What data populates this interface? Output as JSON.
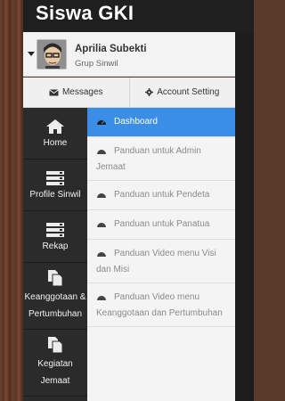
{
  "header": {
    "brand": "Siswa GKI"
  },
  "user": {
    "name": "Aprilia Subekti",
    "group": "Grup Sinwil"
  },
  "actions": {
    "messages": "Messages",
    "account": "Account Setting"
  },
  "nav": [
    {
      "label": "Home",
      "icon": "home-icon"
    },
    {
      "label": "Profile Sinwil",
      "icon": "list-icon"
    },
    {
      "label": "Rekap",
      "icon": "list-icon"
    },
    {
      "label": "Keanggotaan & Pertumbuhan",
      "icon": "copy-icon"
    },
    {
      "label": "Kegiatan Jemaat",
      "icon": "copy-icon"
    }
  ],
  "submenu": [
    {
      "label": "Dashboard",
      "active": true
    },
    {
      "label": "Panduan untuk Admin Jemaat"
    },
    {
      "label": "Panduan untuk Pendeta"
    },
    {
      "label": "Panduan untuk Panatua"
    },
    {
      "label": "Panduan Video menu Visi dan Misi"
    },
    {
      "label": "Panduan Video menu Keanggotaan dan Pertumbuhan"
    }
  ],
  "colors": {
    "header": "#1f1f1f",
    "active": "#3a8ee6",
    "nav": "#2b2b2b"
  }
}
